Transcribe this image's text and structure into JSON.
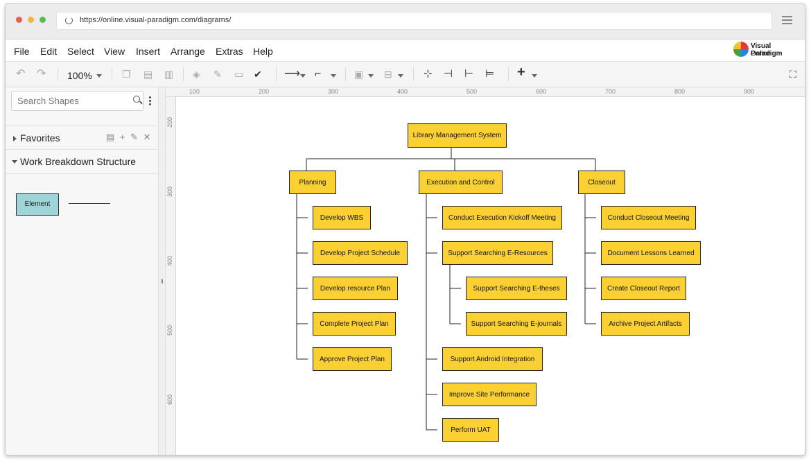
{
  "browser": {
    "url": "https://online.visual-paradigm.com/diagrams/"
  },
  "menu": [
    "File",
    "Edit",
    "Select",
    "View",
    "Insert",
    "Arrange",
    "Extras",
    "Help"
  ],
  "logo": {
    "line1": "Visual Paradigm",
    "line2": "Online"
  },
  "toolbar": {
    "zoom": "100%"
  },
  "sidebar": {
    "search_placeholder": "Search Shapes",
    "favorites": "Favorites",
    "wbs": "Work Breakdown Structure",
    "shape_element": "Element"
  },
  "ruler": {
    "top": [
      "100",
      "200",
      "300",
      "400",
      "500",
      "600",
      "700",
      "800",
      "900"
    ],
    "left": [
      "200",
      "300",
      "400",
      "500",
      "600"
    ]
  },
  "diagram": {
    "root": "Library Management System",
    "branches": [
      {
        "label": "Planning",
        "children": [
          {
            "label": "Develop WBS"
          },
          {
            "label": "Develop Project Schedule"
          },
          {
            "label": "Develop resource Plan"
          },
          {
            "label": "Complete Project Plan"
          },
          {
            "label": "Approve Project Plan"
          }
        ]
      },
      {
        "label": "Execution and Control",
        "children": [
          {
            "label": "Conduct Execution Kickoff Meeting"
          },
          {
            "label": "Support Searching E-Resources",
            "children": [
              {
                "label": "Support Searching E-theses"
              },
              {
                "label": "Support Searching E-journals"
              }
            ]
          },
          {
            "label": "Support Android Integration"
          },
          {
            "label": "Improve Site Performance"
          },
          {
            "label": "Perform UAT"
          }
        ]
      },
      {
        "label": "Closeout",
        "children": [
          {
            "label": "Conduct Closeout Meeting"
          },
          {
            "label": "Document Lessons Learned"
          },
          {
            "label": "Create Closeout Report"
          },
          {
            "label": "Archive Project Artifacts"
          }
        ]
      }
    ]
  },
  "colors": {
    "node_fill": "#fbd033",
    "element_fill": "#9fd4d8"
  }
}
